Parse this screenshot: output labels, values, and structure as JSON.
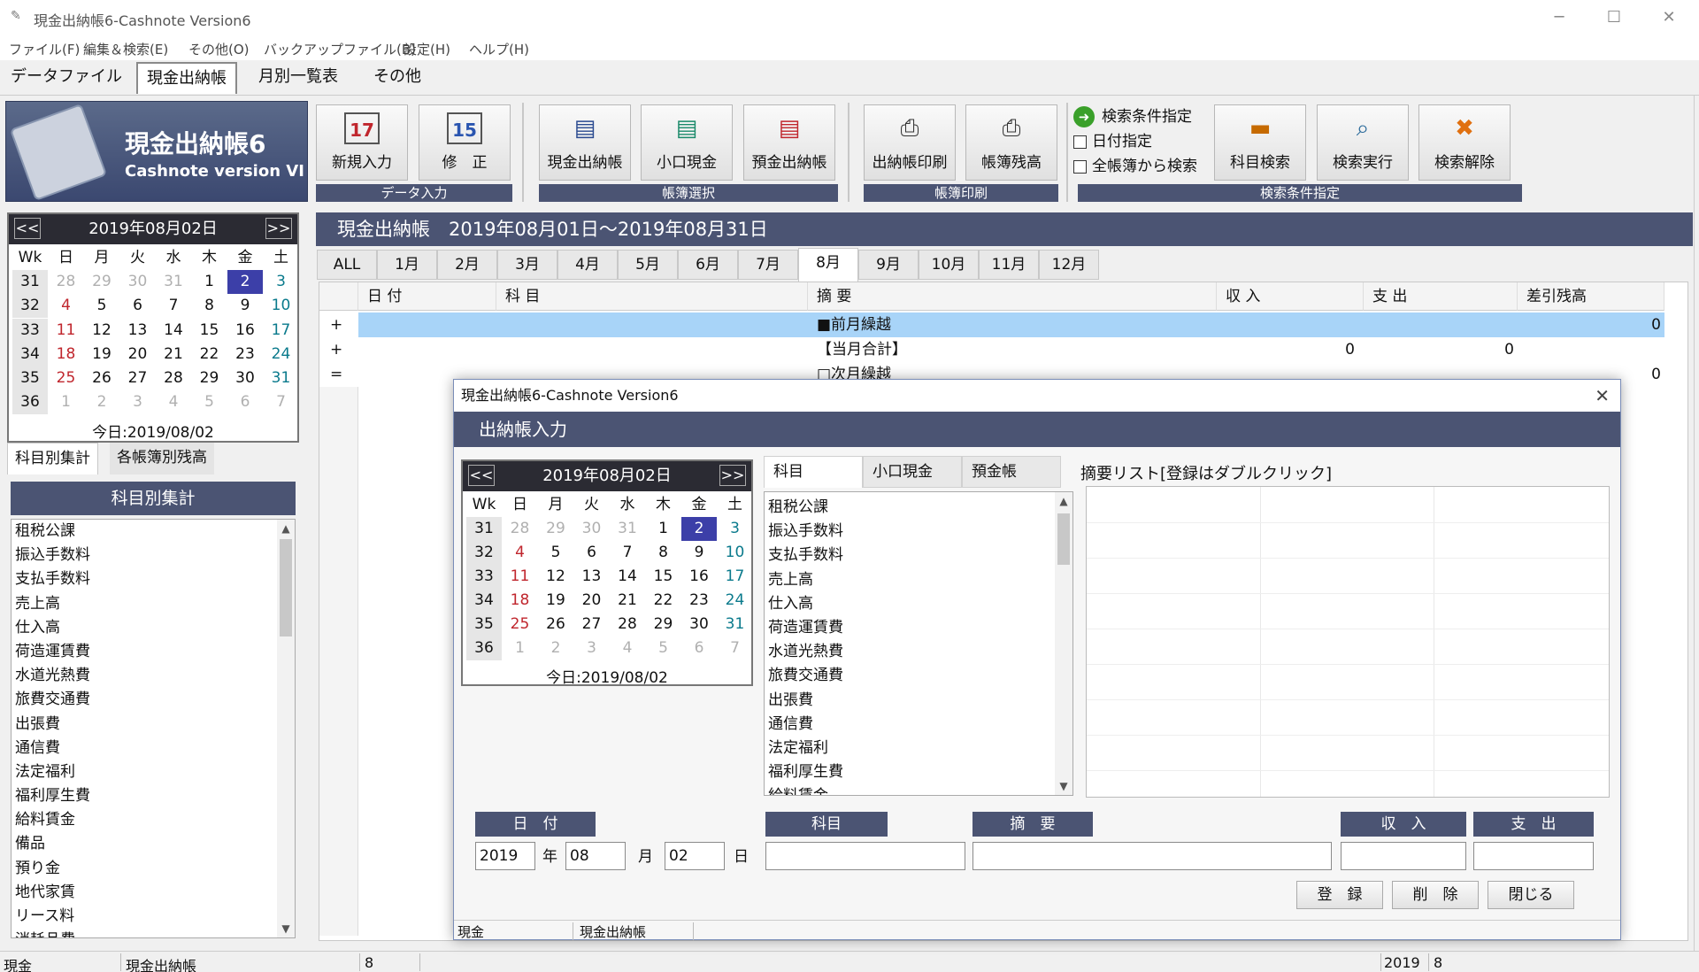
{
  "window": {
    "title": "現金出納帳6-Cashnote Version6",
    "icon": "app-icon",
    "controls": {
      "minimize": "─",
      "maximize": "☐",
      "close": "✕"
    }
  },
  "menu": [
    "ファイル(F)",
    "編集＆検索(E)",
    "その他(O)",
    "バックアップファイル(B)",
    "設定(H)",
    "ヘルプ(H)"
  ],
  "top_tabs": [
    "データファイル",
    "現金出納帳",
    "月別一覧表",
    "その他"
  ],
  "logo": {
    "title": "現金出納帳6",
    "subtitle": "Cashnote version VI"
  },
  "toolbar": {
    "buttons": [
      {
        "label": "新規入力",
        "icon": "calendar-17-icon",
        "glyph": "17"
      },
      {
        "label": "修　正",
        "icon": "calendar-15-icon",
        "glyph": "15"
      },
      {
        "label": "現金出納帳",
        "icon": "ledger-icon",
        "glyph": "▤"
      },
      {
        "label": "小口現金",
        "icon": "ledger-icon",
        "glyph": "▤"
      },
      {
        "label": "預金出納帳",
        "icon": "ledger-icon",
        "glyph": "▤"
      },
      {
        "label": "出納帳印刷",
        "icon": "printer-icon",
        "glyph": "⎙"
      },
      {
        "label": "帳簿残高",
        "icon": "printer-icon",
        "glyph": "⎙"
      },
      {
        "label": "科目検索",
        "icon": "folder-search-icon",
        "glyph": "▬"
      },
      {
        "label": "検索実行",
        "icon": "magnifier-icon",
        "glyph": "⌕"
      },
      {
        "label": "検索解除",
        "icon": "cancel-icon",
        "glyph": "✖"
      }
    ],
    "groups": [
      "データ入力",
      "帳簿選択",
      "帳簿印刷",
      "検索条件指定"
    ],
    "search_options": {
      "title": "検索条件指定",
      "date_filter": "日付指定",
      "all_books": "全帳簿から検索"
    }
  },
  "main": {
    "header": "現金出納帳　2019年08月01日〜2019年08月31日",
    "month_tabs": [
      "ALL",
      "1月",
      "2月",
      "3月",
      "4月",
      "5月",
      "6月",
      "7月",
      "8月",
      "9月",
      "10月",
      "11月",
      "12月"
    ],
    "active_month": "8月",
    "columns": [
      "日 付",
      "科 目",
      "摘 要",
      "収 入",
      "支 出",
      "差引残高"
    ],
    "rows": [
      {
        "mark": "+",
        "summary": "■前月繰越",
        "income": "",
        "expense": "",
        "balance": "0"
      },
      {
        "mark": "+",
        "summary": "【当月合計】",
        "income": "0",
        "expense": "0",
        "balance": ""
      },
      {
        "mark": "=",
        "summary": "□次月繰越",
        "income": "",
        "expense": "",
        "balance": "0"
      }
    ]
  },
  "calendar": {
    "title": "2019年08月02日",
    "prev": "<<",
    "next": ">>",
    "headers": [
      "Wk",
      "日",
      "月",
      "火",
      "水",
      "木",
      "金",
      "土"
    ],
    "weeks": [
      [
        "31",
        "28",
        "29",
        "30",
        "31",
        "1",
        "2",
        "3"
      ],
      [
        "32",
        "4",
        "5",
        "6",
        "7",
        "8",
        "9",
        "10"
      ],
      [
        "33",
        "11",
        "12",
        "13",
        "14",
        "15",
        "16",
        "17"
      ],
      [
        "34",
        "18",
        "19",
        "20",
        "21",
        "22",
        "23",
        "24"
      ],
      [
        "35",
        "25",
        "26",
        "27",
        "28",
        "29",
        "30",
        "31"
      ],
      [
        "36",
        "1",
        "2",
        "3",
        "4",
        "5",
        "6",
        "7"
      ]
    ],
    "today": "今日:2019/08/02"
  },
  "left": {
    "tabs": [
      "科目別集計",
      "各帳簿別残高"
    ],
    "panel_title": "科目別集計",
    "items": [
      "租税公課",
      "振込手数料",
      "支払手数料",
      "売上高",
      "仕入高",
      "荷造運賃費",
      "水道光熱費",
      "旅費交通費",
      "出張費",
      "通信費",
      "法定福利",
      "福利厚生費",
      "給料賃金",
      "備品",
      "預り金",
      "地代家賃",
      "リース料",
      "消耗品費"
    ]
  },
  "status": {
    "book": "現金",
    "ledger": "現金出納帳",
    "month": "8",
    "year": "2019",
    "month2": "8"
  },
  "dialog": {
    "title": "現金出納帳6-Cashnote Version6",
    "close": "✕",
    "header": "出納帳入力",
    "subject_tabs": [
      "科目",
      "小口現金",
      "預金帳"
    ],
    "subjects": [
      "租税公課",
      "振込手数料",
      "支払手数料",
      "売上高",
      "仕入高",
      "荷造運賃費",
      "水道光熱費",
      "旅費交通費",
      "出張費",
      "通信費",
      "法定福利",
      "福利厚生費",
      "給料賃金"
    ],
    "memo_label": "摘要リスト[登録はダブルクリック]",
    "fields": {
      "date_label": "日　付",
      "year": "2019",
      "year_unit": "年",
      "month": "08",
      "month_unit": "月",
      "day": "02",
      "day_unit": "日",
      "subject_label": "科目",
      "summary_label": "摘　要",
      "income_label": "収　入",
      "expense_label": "支　出"
    },
    "buttons": {
      "register": "登　録",
      "delete": "削　除",
      "close": "閉じる"
    },
    "status": {
      "book": "現金",
      "ledger": "現金出納帳"
    }
  }
}
